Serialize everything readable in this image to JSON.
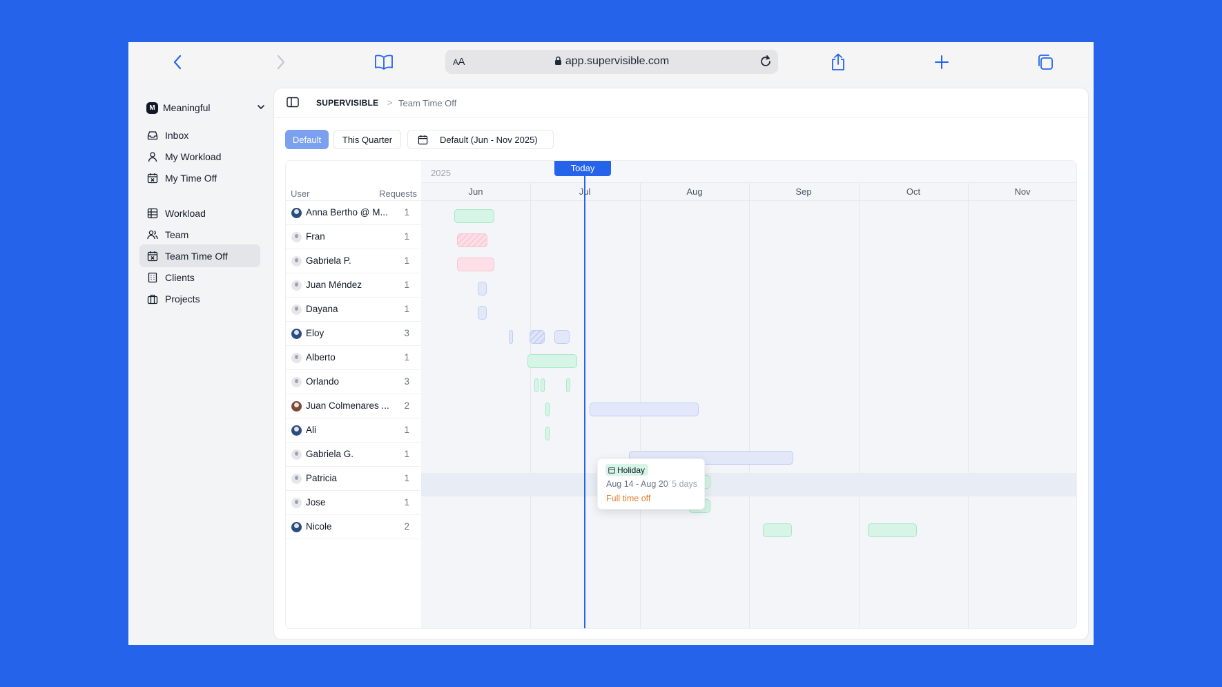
{
  "browser": {
    "url": "app.supervisible.com",
    "text_size_label": "AA"
  },
  "sidebar": {
    "workspace": {
      "initial": "M",
      "name": "Meaningful"
    },
    "items": [
      {
        "label": "Inbox",
        "icon": "inbox-icon"
      },
      {
        "label": "My Workload",
        "icon": "user-icon"
      },
      {
        "label": "My Time Off",
        "icon": "calendar-x-icon"
      },
      {
        "label": "Workload",
        "icon": "grid-icon"
      },
      {
        "label": "Team",
        "icon": "users-icon"
      },
      {
        "label": "Team Time Off",
        "icon": "calendar-x-icon",
        "active": true
      },
      {
        "label": "Clients",
        "icon": "building-icon"
      },
      {
        "label": "Projects",
        "icon": "briefcase-icon"
      }
    ]
  },
  "header": {
    "brand": "SUPERVISIBLE",
    "separator": ">",
    "page": "Team Time Off"
  },
  "filters": {
    "default": "Default",
    "quarter": "This Quarter",
    "range": "Default (Jun - Nov 2025)"
  },
  "timeline": {
    "year": "2025",
    "today_label": "Today",
    "col_user": "User",
    "col_requests": "Requests",
    "months": [
      "Jun",
      "Jul",
      "Aug",
      "Sep",
      "Oct",
      "Nov"
    ],
    "users": [
      {
        "name": "Anna Bertho @ M...",
        "requests": "1"
      },
      {
        "name": "Fran",
        "requests": "1"
      },
      {
        "name": "Gabriela P.",
        "requests": "1"
      },
      {
        "name": "Juan Méndez",
        "requests": "1"
      },
      {
        "name": "Dayana",
        "requests": "1"
      },
      {
        "name": "Eloy",
        "requests": "3"
      },
      {
        "name": "Alberto",
        "requests": "1"
      },
      {
        "name": "Orlando",
        "requests": "3"
      },
      {
        "name": "Juan Colmenares ...",
        "requests": "2"
      },
      {
        "name": "Ali",
        "requests": "1"
      },
      {
        "name": "Gabriela G.",
        "requests": "1"
      },
      {
        "name": "Patricia",
        "requests": "1"
      },
      {
        "name": "Jose",
        "requests": "1"
      },
      {
        "name": "Nicole",
        "requests": "2"
      }
    ]
  },
  "tooltip": {
    "tag": "Holiday",
    "range": "Aug 14 - Aug 20",
    "days": "5 days",
    "type": "Full time off"
  },
  "colors": {
    "accent": "#2563eb",
    "holiday": "#d6f5e6",
    "sick": "#fde0e7",
    "other": "#e2e7f9",
    "full_time_off": "#ea7a2c"
  }
}
